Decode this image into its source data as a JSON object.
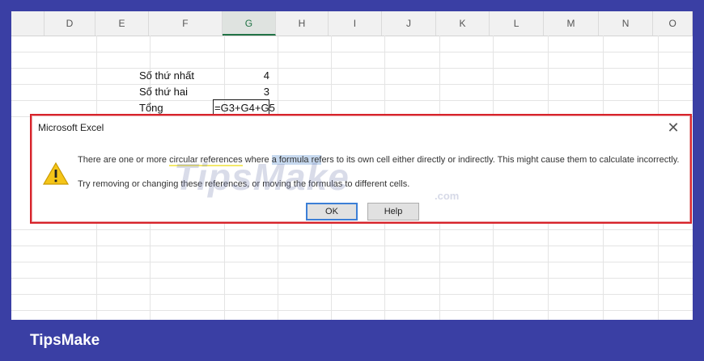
{
  "spreadsheet": {
    "columns": [
      "D",
      "E",
      "F",
      "G",
      "H",
      "I",
      "J",
      "K",
      "L",
      "M",
      "N",
      "O"
    ],
    "active_column": "G",
    "rows": [
      {
        "label": "Số thứ nhất",
        "value": "4"
      },
      {
        "label": "Số thứ hai",
        "value": "3"
      },
      {
        "label": "Tổng",
        "value": "=G3+G4+G5"
      }
    ]
  },
  "dialog": {
    "title": "Microsoft Excel",
    "close_glyph": "✕",
    "message_line1_a": "There are one or more ",
    "message_line1_b": "circular references",
    "message_line1_c": " where ",
    "message_line1_d": "a formula ref",
    "message_line1_e": "ers to its own cell either directly or indirectly. This might cause them to calculate incorrectly.",
    "message_line2": "Try removing or changing these references, or moving the formulas to different cells.",
    "ok_label": "OK",
    "help_label": "Help",
    "icon": "warning-icon"
  },
  "watermark": {
    "text": "TipsMake",
    "suffix": ".com"
  },
  "footer": {
    "brand": "TipsMake"
  },
  "colors": {
    "frame": "#3a3fa4",
    "dialog_border": "#d8232a",
    "excel_green": "#217346",
    "warning_yellow": "#f5c518"
  }
}
